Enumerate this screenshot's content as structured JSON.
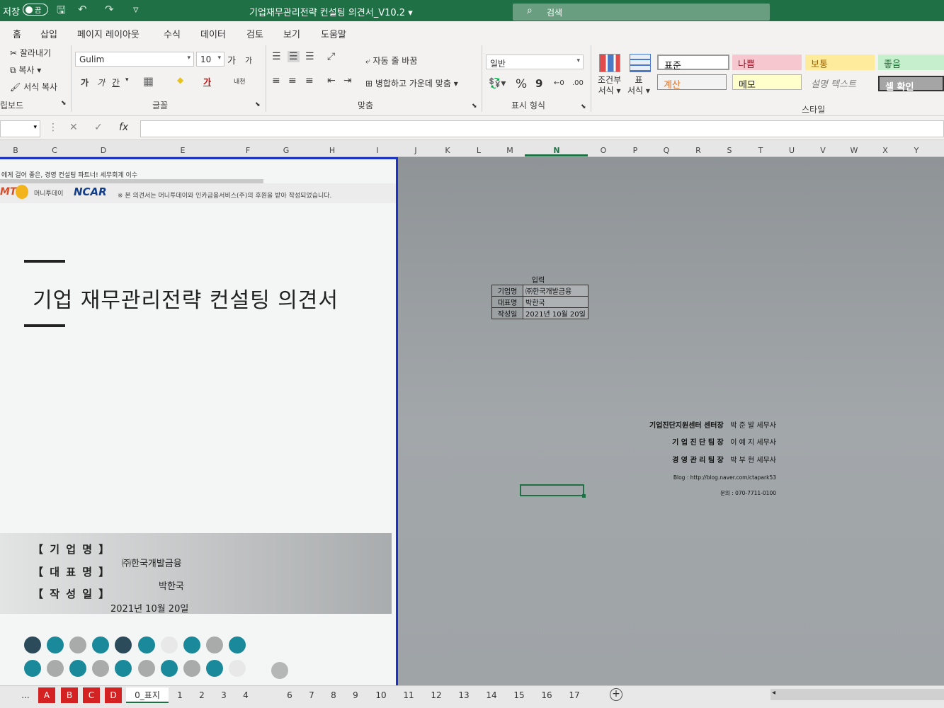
{
  "titlebar": {
    "autosave_label": "저장",
    "autosave_state": "끔",
    "doc_title": "기업재무관리전략 컨설팅 의견서_V10.2",
    "title_caret": "▾",
    "search_placeholder": "검색",
    "search_icon": "⌕",
    "save_icon": "🖫",
    "undo_icon": "↶",
    "redo_icon": "↷",
    "customize_icon": "▿"
  },
  "tabs": [
    "홈",
    "삽입",
    "페이지 레이아웃",
    "수식",
    "데이터",
    "검토",
    "보기",
    "도움말"
  ],
  "ribbon": {
    "clipboard": {
      "cut": "잘라내기",
      "copy": "복사",
      "format_painter": "서식 복사",
      "group": "립보드"
    },
    "font": {
      "name": "Gulim",
      "size": "10",
      "grow": "가",
      "shrink": "가",
      "bold": "가",
      "italic": "가",
      "underline": "간",
      "border_icon": "▦",
      "fill_icon": "◆",
      "color_icon": "가",
      "phonetic": "내천",
      "group": "글꼴"
    },
    "align": {
      "wrap": "자동 줄 바꿈",
      "merge": "병합하고 가운데 맞춤",
      "group": "맞춤"
    },
    "number": {
      "format": "일반",
      "percent": "%",
      "comma": "9",
      "inc": "←0",
      "dec": ".00",
      "group": "표시 형식"
    },
    "styles": {
      "conditional": [
        "조건부",
        "서식"
      ],
      "table": [
        "표",
        "서식"
      ],
      "cells": [
        {
          "label": "표준",
          "bg": "#ffffff",
          "color": "#222222"
        },
        {
          "label": "나쁨",
          "bg": "#f6c7ce",
          "color": "#9c1c2c"
        },
        {
          "label": "보통",
          "bg": "#ffeb9c",
          "color": "#9c6500"
        },
        {
          "label": "좋음",
          "bg": "#c6efce",
          "color": "#1e6b33"
        },
        {
          "label": "계산",
          "bg": "#f2f2f2",
          "color": "#e0701f"
        },
        {
          "label": "메모",
          "bg": "#ffffcc",
          "color": "#222222"
        },
        {
          "label": "설명 텍스트",
          "bg": "#f3f2f1",
          "color": "#7f7f7f"
        },
        {
          "label": "셀 확인",
          "bg": "#a5a5a5",
          "color": "#ffffff"
        }
      ],
      "group": "스타일"
    }
  },
  "formula_bar": {
    "cancel": "✕",
    "enter": "✓",
    "fx": "fx",
    "value": ""
  },
  "columns": [
    "B",
    "C",
    "D",
    "E",
    "F",
    "G",
    "H",
    "I",
    "J",
    "K",
    "L",
    "M",
    "N",
    "O",
    "P",
    "Q",
    "R",
    "S",
    "T",
    "U",
    "V",
    "W",
    "X",
    "Y"
  ],
  "page": {
    "slogan": "에게 걸어 좋은, 경영 컨설팅 파트너! 세무회계 이수",
    "logo1": "MT",
    "logo2": "머니투데이",
    "logo3": "NCAR",
    "notice": "※ 본 의견서는 머니투데이와 인카금융서비스(주)의 후원을 받아 작성되었습니다.",
    "title": "기업 재무관리전략 컨설팅 의견서",
    "labels": [
      "【 기 업 명 】",
      "【 대 표 명 】",
      "【 작 성 일 】"
    ],
    "company": "㈜한국개발금융",
    "ceo": "박한국",
    "date": "2021년 10월 20일"
  },
  "input_table": {
    "heading": "입력",
    "rows": [
      {
        "key": "기업명",
        "value": "㈜한국개발금융"
      },
      {
        "key": "대표명",
        "value": "박한국"
      },
      {
        "key": "작성일",
        "value": "2021년 10월 20일"
      }
    ]
  },
  "staff": {
    "rows": [
      {
        "title": "기업진단지원센터 센터장",
        "name": "박 준 발  세무사"
      },
      {
        "title": "기 업 진 단 팀 장",
        "name": "이 예 지  세무사"
      },
      {
        "title": "경 영 관 리 팀 장",
        "name": "박 부 현  세무사"
      }
    ],
    "blog": "Blog : http://blog.naver.com/ctapark53",
    "phone": "문의 : 070-7711-0100"
  },
  "sheet_tabs": {
    "more": "...",
    "red_tabs": [
      "A",
      "B",
      "C",
      "D"
    ],
    "active": "0_표지",
    "numbered": [
      "1",
      "2",
      "3",
      "4",
      "6",
      "7",
      "8",
      "9",
      "10",
      "11",
      "12",
      "13",
      "14",
      "15",
      "16",
      "17"
    ],
    "add": "+"
  }
}
